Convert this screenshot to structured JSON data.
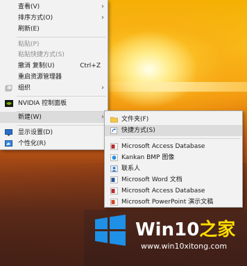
{
  "context_menu": {
    "items": [
      {
        "label": "查看(V)"
      },
      {
        "label": "排序方式(O)"
      },
      {
        "label": "刷新(E)"
      },
      {
        "label": "粘贴(P)"
      },
      {
        "label": "粘贴快捷方式(S)"
      },
      {
        "label": "撤消 复制(U)",
        "shortcut": "Ctrl+Z"
      },
      {
        "label": "重启资源管理器"
      },
      {
        "label": "组织"
      },
      {
        "label": "NVIDIA 控制面板"
      },
      {
        "label": "新建(W)"
      },
      {
        "label": "显示设置(D)"
      },
      {
        "label": "个性化(R)"
      }
    ]
  },
  "new_submenu": {
    "items": [
      {
        "label": "文件夹(F)",
        "icon": "folder-icon"
      },
      {
        "label": "快捷方式(S)",
        "icon": "shortcut-icon"
      },
      {
        "label": "Microsoft Access Database",
        "icon": "access-icon"
      },
      {
        "label": "Kankan BMP 图像",
        "icon": "bmp-icon"
      },
      {
        "label": "联系人",
        "icon": "contact-icon"
      },
      {
        "label": "Microsoft Word 文档",
        "icon": "word-icon"
      },
      {
        "label": "Microsoft Access Database",
        "icon": "access-icon"
      },
      {
        "label": "Microsoft PowerPoint 演示文稿",
        "icon": "powerpoint-icon"
      }
    ]
  },
  "watermark": {
    "title_main": "Win10",
    "title_accent": "之家",
    "url": "www.win10xitong.com"
  },
  "colors": {
    "menu_bg": "#f2f2f2",
    "highlight": "#dcdcdc",
    "win_blue": "#1e90e6",
    "accent_yellow": "#ffdd00"
  }
}
